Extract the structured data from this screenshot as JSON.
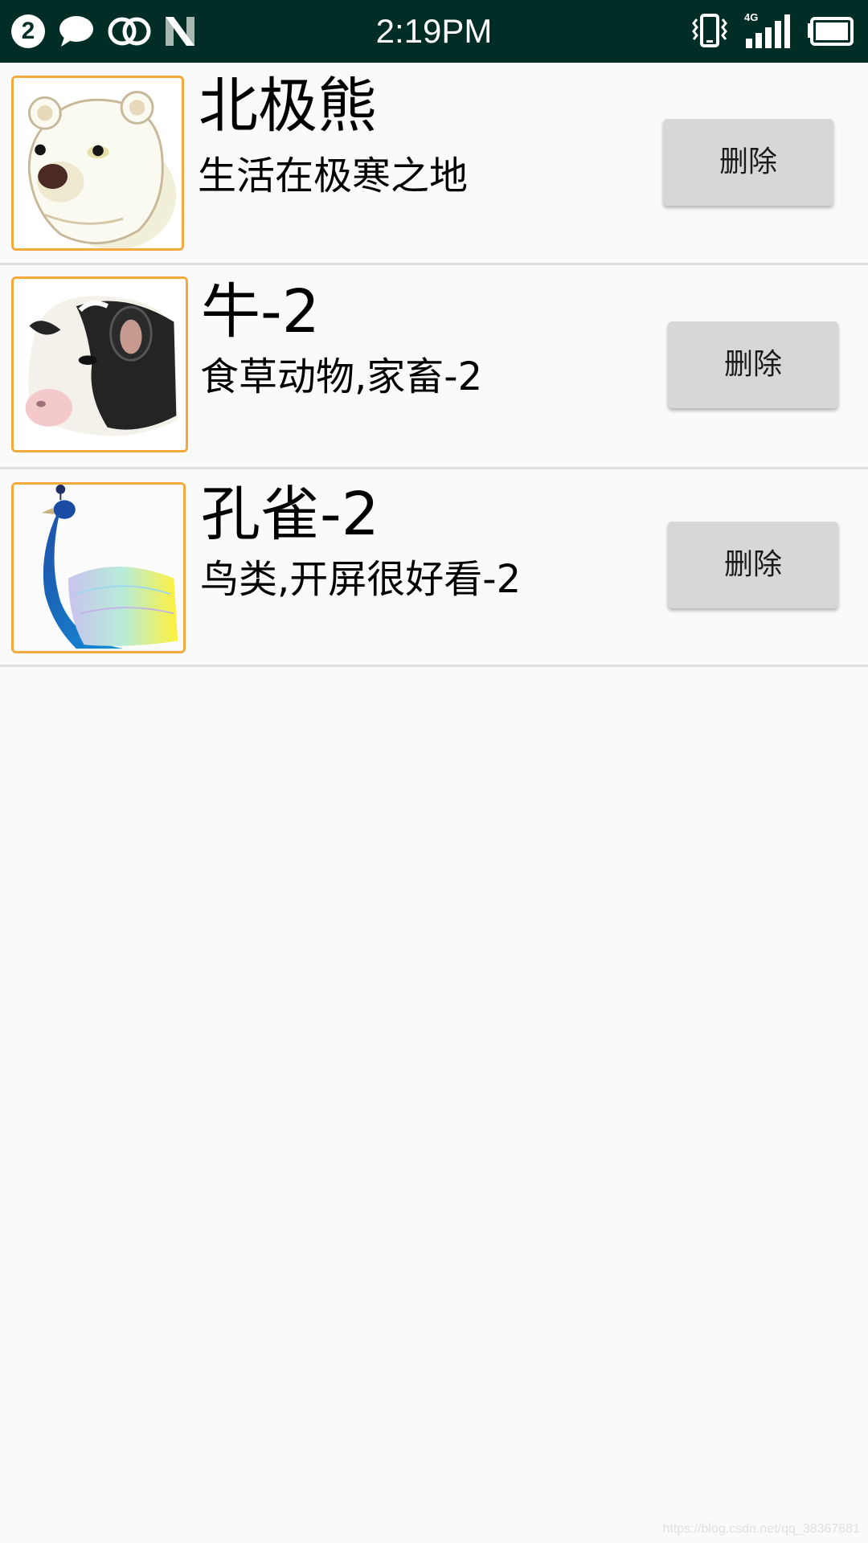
{
  "status_bar": {
    "notification_count": "2",
    "time": "2:19PM",
    "network_type": "4G",
    "left_icons": [
      "notification-count-badge",
      "message-bubble-icon",
      "linked-circles-icon",
      "n-logo-icon"
    ],
    "right_icons": [
      "vibrate-icon",
      "signal-icon",
      "battery-icon"
    ],
    "background_color": "#002e26"
  },
  "animals": [
    {
      "name": "北极熊",
      "description": "生活在极寒之地",
      "delete_label": "删除",
      "image": "polar-bear-image"
    },
    {
      "name": "牛-2",
      "description": "食草动物,家畜-2",
      "delete_label": "删除",
      "image": "cow-image"
    },
    {
      "name": "孔雀-2",
      "description": "鸟类,开屏很好看-2",
      "delete_label": "删除",
      "image": "peacock-image"
    }
  ],
  "watermark": "https://blog.csdn.net/qq_38367681",
  "colors": {
    "thumbnail_border": "#f3a93b",
    "button_background": "#d6d7d7",
    "divider": "#dedede",
    "page_background": "#fafafa"
  }
}
